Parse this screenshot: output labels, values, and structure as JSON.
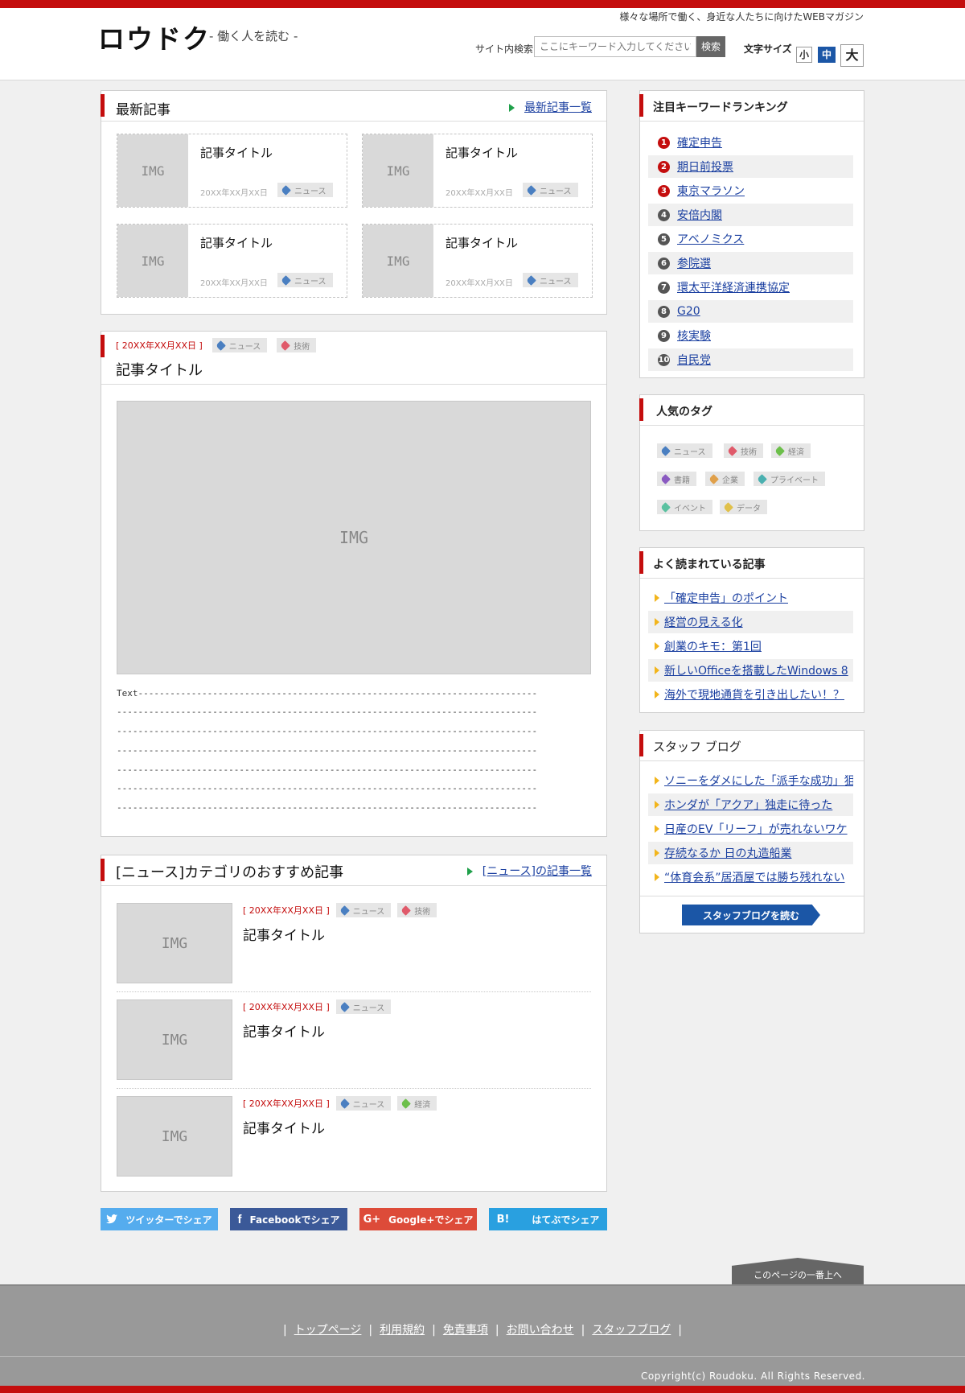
{
  "header": {
    "logo": "ロウドク",
    "logo_sub": "- 働く人を読む -",
    "tagline": "様々な場所で働く、身近な人たちに向けたWEBマガジン",
    "search_label": "サイト内検索",
    "search_placeholder": "ここにキーワード入力してください",
    "search_button": "検索",
    "font_size_label": "文字サイズ",
    "font_small": "小",
    "font_medium": "中",
    "font_large": "大"
  },
  "latest": {
    "title": "最新記事",
    "more_link": "最新記事一覧",
    "cards": [
      {
        "img": "IMG",
        "title": "記事タイトル",
        "date": "20XX年XX月XX日",
        "tag": "ニュース"
      },
      {
        "img": "IMG",
        "title": "記事タイトル",
        "date": "20XX年XX月XX日",
        "tag": "ニュース"
      },
      {
        "img": "IMG",
        "title": "記事タイトル",
        "date": "20XX年XX月XX日",
        "tag": "ニュース"
      },
      {
        "img": "IMG",
        "title": "記事タイトル",
        "date": "20XX年XX月XX日",
        "tag": "ニュース"
      }
    ]
  },
  "feature": {
    "date": "[ 20XX年XX月XX日 ]",
    "tags": [
      "ニュース",
      "技術"
    ],
    "title": "記事タイトル",
    "img": "IMG",
    "text_lines": [
      "Text---------------------------------------------------------------------------",
      "-------------------------------------------------------------------------------",
      "-------------------------------------------------------------------------------",
      "-------------------------------------------------------------------------------",
      "-------------------------------------------------------------------------------",
      "-------------------------------------------------------------------------------",
      "-------------------------------------------------------------------------------"
    ]
  },
  "category": {
    "title": "[ニュース]カテゴリのおすすめ記事",
    "more_link": "[ニュース]の記事一覧",
    "items": [
      {
        "img": "IMG",
        "date": "[ 20XX年XX月XX日 ]",
        "tags": [
          "ニュース",
          "技術"
        ],
        "title": "記事タイトル"
      },
      {
        "img": "IMG",
        "date": "[ 20XX年XX月XX日 ]",
        "tags": [
          "ニュース"
        ],
        "title": "記事タイトル"
      },
      {
        "img": "IMG",
        "date": "[ 20XX年XX月XX日 ]",
        "tags": [
          "ニュース",
          "経済"
        ],
        "title": "記事タイトル"
      }
    ]
  },
  "share": {
    "twitter": "ツイッターでシェア",
    "facebook": "Facebookでシェア",
    "google": "Google+でシェア",
    "hatena": "はてぶでシェア",
    "hatena_icon": "B!",
    "twitter_color": "#55acee",
    "facebook_color": "#3b5998",
    "google_color": "#dd4b39",
    "hatena_color": "#29a0e0"
  },
  "ranking": {
    "title": "注目キーワードランキング",
    "items": [
      {
        "num": "1",
        "label": "確定申告",
        "color": "#c40d0d"
      },
      {
        "num": "2",
        "label": "期日前投票",
        "color": "#c40d0d"
      },
      {
        "num": "3",
        "label": "東京マラソン",
        "color": "#c40d0d"
      },
      {
        "num": "4",
        "label": "安倍内閣",
        "color": "#555555"
      },
      {
        "num": "5",
        "label": "アベノミクス",
        "color": "#555555"
      },
      {
        "num": "6",
        "label": "参院選",
        "color": "#555555"
      },
      {
        "num": "7",
        "label": "環太平洋経済連携協定",
        "color": "#555555"
      },
      {
        "num": "8",
        "label": "G20",
        "color": "#555555"
      },
      {
        "num": "9",
        "label": "核実験",
        "color": "#555555"
      },
      {
        "num": "10",
        "label": "自民党",
        "color": "#555555"
      }
    ]
  },
  "tags_popular": {
    "title": "人気のタグ",
    "tags": [
      {
        "label": "ニュース",
        "color": "#4a7fc1"
      },
      {
        "label": "技術",
        "color": "#e05a6a"
      },
      {
        "label": "経済",
        "color": "#6cbf4a"
      },
      {
        "label": "書籍",
        "color": "#8a5ac1"
      },
      {
        "label": "企業",
        "color": "#e0a04a"
      },
      {
        "label": "プライベート",
        "color": "#4ab0b0"
      },
      {
        "label": "イベント",
        "color": "#5ac1a0"
      },
      {
        "label": "データ",
        "color": "#e0c04a"
      }
    ]
  },
  "popular": {
    "title": "よく読まれている記事",
    "items": [
      "「確定申告」のポイント",
      "経営の見える化",
      "創業のキモ：第1回",
      "新しいOfficeを搭載したWindows 8",
      "海外で現地通貨を引き出したい！？"
    ]
  },
  "blog": {
    "title": "スタッフ ブログ",
    "items": [
      "ソニーをダメにした「派手な成功」狙い",
      "ホンダが「アクア」独走に待った",
      "日産のEV「リーフ」が売れないワケ",
      "存続なるか 日の丸造船業",
      "“体育会系”居酒屋では勝ち残れない"
    ],
    "button": "スタッフブログを読む"
  },
  "footer": {
    "page_top": "このページの一番上へ",
    "nav": [
      "トップページ",
      "利用規約",
      "免責事項",
      "お問い合わせ",
      "スタッフブログ"
    ],
    "copyright": "Copyright(c) Roudoku. All Rights Reserved."
  }
}
